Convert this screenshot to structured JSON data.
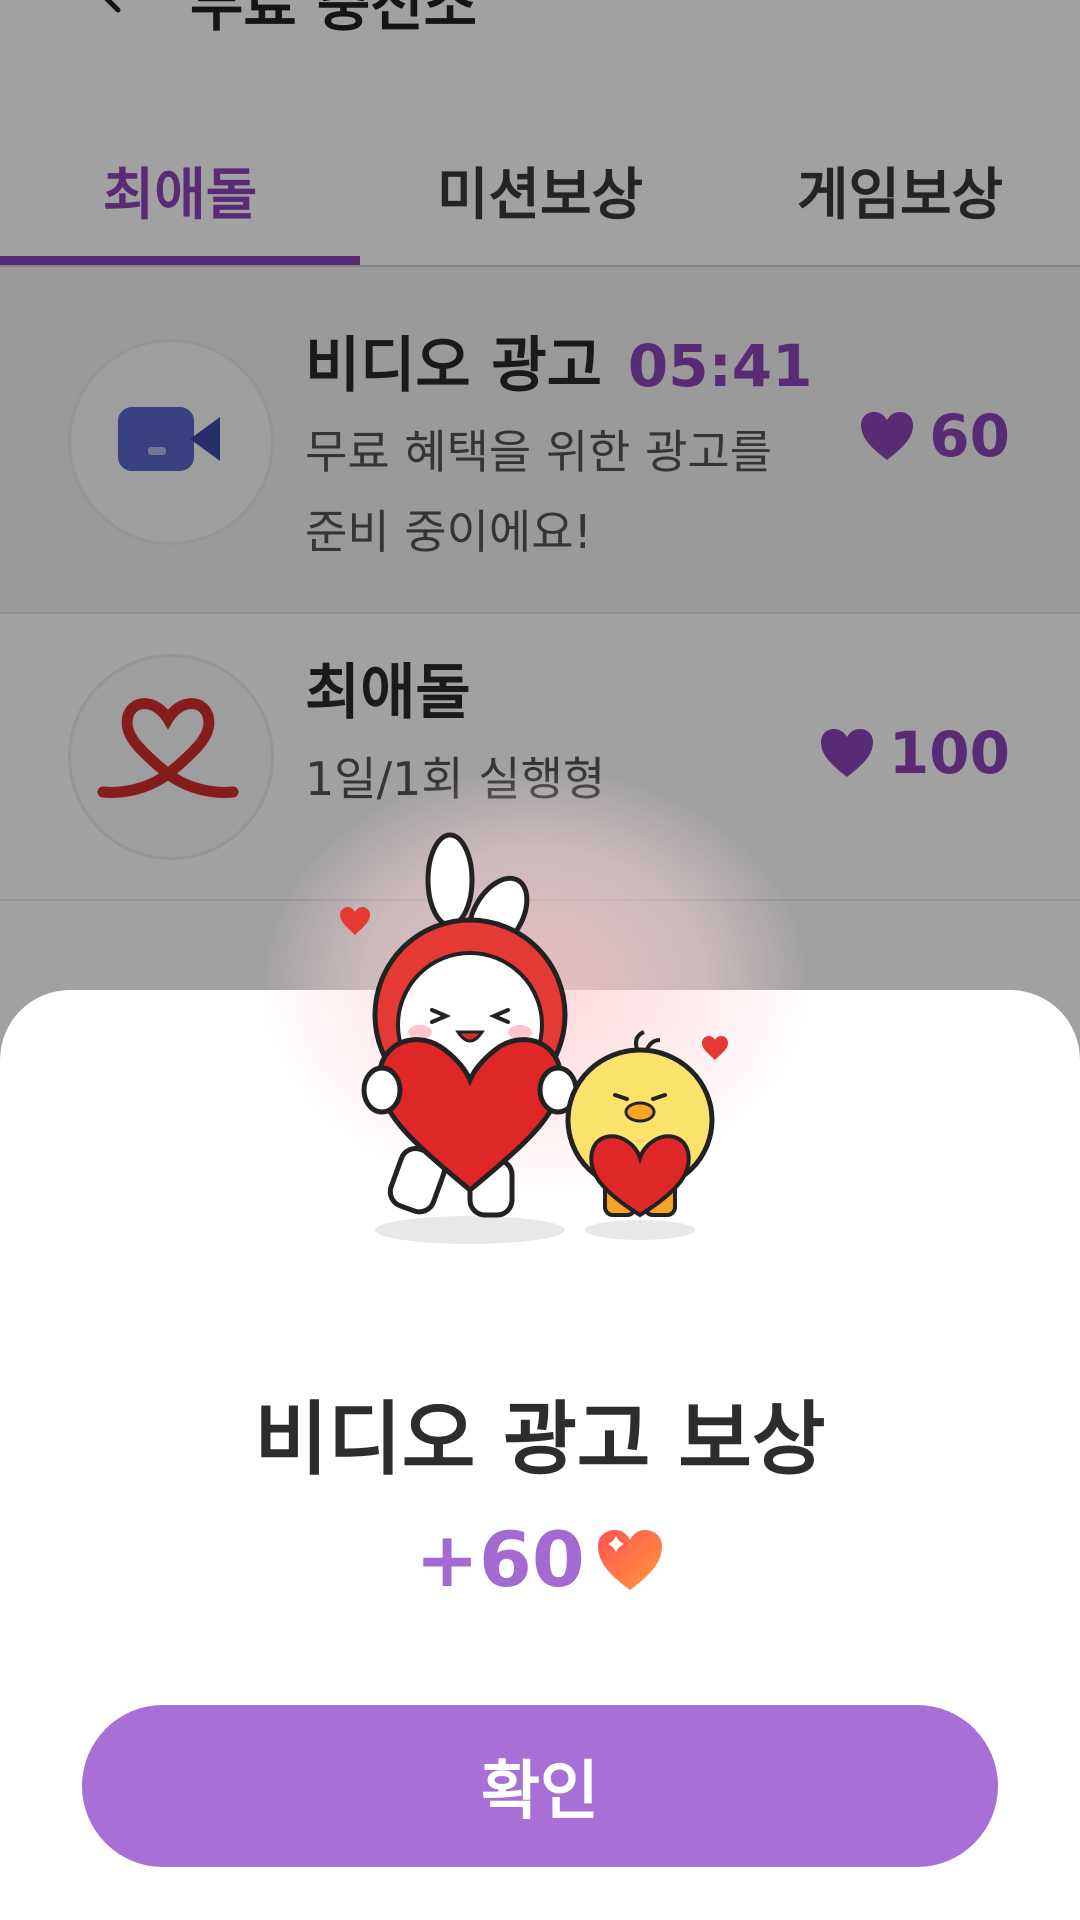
{
  "header": {
    "title": "무료 충전소"
  },
  "tabs": [
    {
      "label": "최애돌",
      "active": true
    },
    {
      "label": "미션보상",
      "active": false
    },
    {
      "label": "게임보상",
      "active": false
    }
  ],
  "rows": [
    {
      "title": "비디오 광고",
      "timer": "05:41",
      "desc_line1": "무료 혜택을 위한 광고를",
      "desc_line2": "준비 중이에요!",
      "reward": "60",
      "icon": "video-camera-icon"
    },
    {
      "title": "최애돌",
      "desc_line1": "1일/1회 실행형",
      "reward": "100",
      "icon": "ribbon-heart-icon"
    }
  ],
  "dialog": {
    "title": "비디오 광고 보상",
    "amount": "+60",
    "confirm_label": "확인",
    "icon": "heart-icon"
  },
  "colors": {
    "accent": "#8e44b8",
    "button": "#a86fd6",
    "amount": "#a36ad2",
    "heart_red": "#e53935"
  }
}
